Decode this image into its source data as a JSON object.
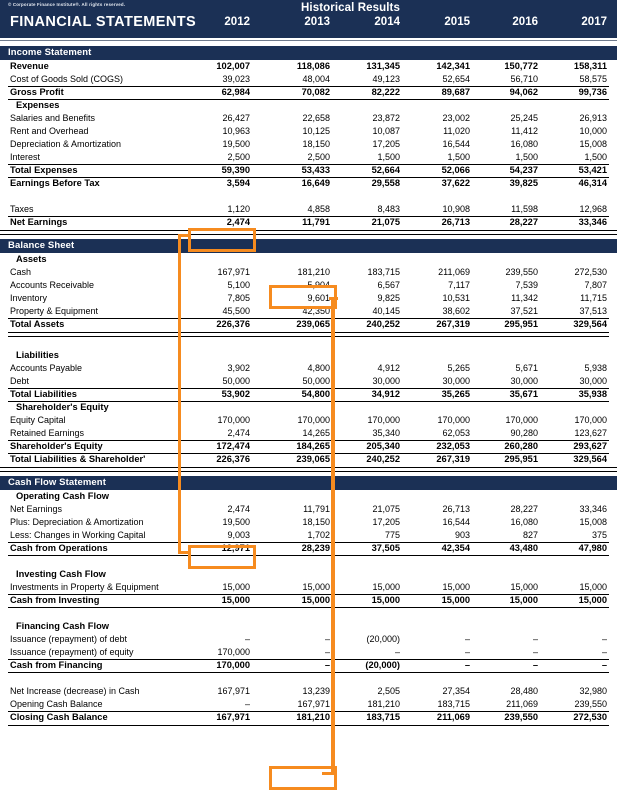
{
  "header": {
    "copyright": "© Corporate Finance Institute®. All rights reserved.",
    "historical_label": "Historical Results",
    "title": "FINANCIAL STATEMENTS",
    "years": [
      "2012",
      "2013",
      "2014",
      "2015",
      "2016",
      "2017"
    ],
    "background_color": "#1b3055",
    "text_color": "#ffffff"
  },
  "accent_color": "#F68B1F",
  "sections": [
    {
      "name": "income-statement",
      "title": "Income Statement",
      "rows": [
        {
          "label": "Revenue",
          "bold": true,
          "indent": false,
          "values": [
            "102,007",
            "118,086",
            "131,345",
            "142,341",
            "150,772",
            "158,311"
          ]
        },
        {
          "label": "Cost of Goods Sold (COGS)",
          "bold": false,
          "indent": false,
          "values": [
            "39,023",
            "48,004",
            "49,123",
            "52,654",
            "56,710",
            "58,575"
          ]
        },
        {
          "label": "Gross Profit",
          "bold": true,
          "indent": false,
          "values": [
            "62,984",
            "70,082",
            "82,222",
            "89,687",
            "94,062",
            "99,736"
          ]
        },
        {
          "label": "Expenses",
          "bold": true,
          "indent": true,
          "values": [
            "",
            "",
            "",
            "",
            "",
            ""
          ]
        },
        {
          "label": "Salaries and Benefits",
          "bold": false,
          "indent": false,
          "values": [
            "26,427",
            "22,658",
            "23,872",
            "23,002",
            "25,245",
            "26,913"
          ]
        },
        {
          "label": "Rent and Overhead",
          "bold": false,
          "indent": false,
          "values": [
            "10,963",
            "10,125",
            "10,087",
            "11,020",
            "11,412",
            "10,000"
          ]
        },
        {
          "label": "Depreciation & Amortization",
          "bold": false,
          "indent": false,
          "values": [
            "19,500",
            "18,150",
            "17,205",
            "16,544",
            "16,080",
            "15,008"
          ]
        },
        {
          "label": "Interest",
          "bold": false,
          "indent": false,
          "values": [
            "2,500",
            "2,500",
            "1,500",
            "1,500",
            "1,500",
            "1,500"
          ]
        },
        {
          "label": "Total Expenses",
          "bold": true,
          "indent": false,
          "values": [
            "59,390",
            "53,433",
            "52,664",
            "52,066",
            "54,237",
            "53,421"
          ]
        },
        {
          "label": "Earnings Before Tax",
          "bold": true,
          "indent": false,
          "values": [
            "3,594",
            "16,649",
            "29,558",
            "37,622",
            "39,825",
            "46,314"
          ]
        },
        {
          "label": "",
          "bold": false,
          "indent": false,
          "values": [
            "",
            "",
            "",
            "",
            "",
            ""
          ]
        },
        {
          "label": "Taxes",
          "bold": false,
          "indent": false,
          "values": [
            "1,120",
            "4,858",
            "8,483",
            "10,908",
            "11,598",
            "12,968"
          ]
        },
        {
          "label": "Net Earnings",
          "bold": true,
          "indent": false,
          "values": [
            "2,474",
            "11,791",
            "21,075",
            "26,713",
            "28,227",
            "33,346"
          ]
        }
      ]
    },
    {
      "name": "balance-sheet",
      "title": "Balance Sheet",
      "rows": [
        {
          "label": "Assets",
          "bold": true,
          "indent": true,
          "values": [
            "",
            "",
            "",
            "",
            "",
            ""
          ]
        },
        {
          "label": "Cash",
          "bold": false,
          "indent": false,
          "values": [
            "167,971",
            "181,210",
            "183,715",
            "211,069",
            "239,550",
            "272,530"
          ]
        },
        {
          "label": "Accounts Receivable",
          "bold": false,
          "indent": false,
          "values": [
            "5,100",
            "5,904",
            "6,567",
            "7,117",
            "7,539",
            "7,807"
          ]
        },
        {
          "label": "Inventory",
          "bold": false,
          "indent": false,
          "values": [
            "7,805",
            "9,601",
            "9,825",
            "10,531",
            "11,342",
            "11,715"
          ]
        },
        {
          "label": "Property & Equipment",
          "bold": false,
          "indent": false,
          "values": [
            "45,500",
            "42,350",
            "40,145",
            "38,602",
            "37,521",
            "37,513"
          ]
        },
        {
          "label": "Total Assets",
          "bold": true,
          "indent": false,
          "values": [
            "226,376",
            "239,065",
            "240,252",
            "267,319",
            "295,951",
            "329,564"
          ]
        },
        {
          "label": "",
          "bold": false,
          "indent": false,
          "values": [
            "",
            "",
            "",
            "",
            "",
            ""
          ]
        },
        {
          "label": "Liabilities",
          "bold": true,
          "indent": true,
          "values": [
            "",
            "",
            "",
            "",
            "",
            ""
          ]
        },
        {
          "label": "Accounts Payable",
          "bold": false,
          "indent": false,
          "values": [
            "3,902",
            "4,800",
            "4,912",
            "5,265",
            "5,671",
            "5,938"
          ]
        },
        {
          "label": "Debt",
          "bold": false,
          "indent": false,
          "values": [
            "50,000",
            "50,000",
            "30,000",
            "30,000",
            "30,000",
            "30,000"
          ]
        },
        {
          "label": "Total Liabilities",
          "bold": true,
          "indent": false,
          "values": [
            "53,902",
            "54,800",
            "34,912",
            "35,265",
            "35,671",
            "35,938"
          ]
        },
        {
          "label": "Shareholder's Equity",
          "bold": true,
          "indent": true,
          "values": [
            "",
            "",
            "",
            "",
            "",
            ""
          ]
        },
        {
          "label": "Equity Capital",
          "bold": false,
          "indent": false,
          "values": [
            "170,000",
            "170,000",
            "170,000",
            "170,000",
            "170,000",
            "170,000"
          ]
        },
        {
          "label": "Retained Earnings",
          "bold": false,
          "indent": false,
          "values": [
            "2,474",
            "14,265",
            "35,340",
            "62,053",
            "90,280",
            "123,627"
          ]
        },
        {
          "label": "Shareholder's Equity",
          "bold": true,
          "indent": false,
          "values": [
            "172,474",
            "184,265",
            "205,340",
            "232,053",
            "260,280",
            "293,627"
          ]
        },
        {
          "label": "Total Liabilities & Shareholder'",
          "bold": true,
          "indent": false,
          "values": [
            "226,376",
            "239,065",
            "240,252",
            "267,319",
            "295,951",
            "329,564"
          ]
        }
      ]
    },
    {
      "name": "cash-flow-statement",
      "title": "Cash Flow Statement",
      "rows": [
        {
          "label": "Operating Cash Flow",
          "bold": true,
          "indent": true,
          "values": [
            "",
            "",
            "",
            "",
            "",
            ""
          ]
        },
        {
          "label": "Net Earnings",
          "bold": false,
          "indent": false,
          "values": [
            "2,474",
            "11,791",
            "21,075",
            "26,713",
            "28,227",
            "33,346"
          ]
        },
        {
          "label": "Plus: Depreciation & Amortization",
          "bold": false,
          "indent": false,
          "values": [
            "19,500",
            "18,150",
            "17,205",
            "16,544",
            "16,080",
            "15,008"
          ]
        },
        {
          "label": "Less: Changes in Working Capital",
          "bold": false,
          "indent": false,
          "values": [
            "9,003",
            "1,702",
            "775",
            "903",
            "827",
            "375"
          ]
        },
        {
          "label": "Cash from Operations",
          "bold": true,
          "indent": false,
          "values": [
            "12,971",
            "28,239",
            "37,505",
            "42,354",
            "43,480",
            "47,980"
          ]
        },
        {
          "label": "",
          "bold": false,
          "indent": false,
          "values": [
            "",
            "",
            "",
            "",
            "",
            ""
          ]
        },
        {
          "label": "Investing Cash Flow",
          "bold": true,
          "indent": true,
          "values": [
            "",
            "",
            "",
            "",
            "",
            ""
          ]
        },
        {
          "label": "Investments in Property & Equipment",
          "bold": false,
          "indent": false,
          "values": [
            "15,000",
            "15,000",
            "15,000",
            "15,000",
            "15,000",
            "15,000"
          ]
        },
        {
          "label": "Cash from Investing",
          "bold": true,
          "indent": false,
          "values": [
            "15,000",
            "15,000",
            "15,000",
            "15,000",
            "15,000",
            "15,000"
          ]
        },
        {
          "label": "",
          "bold": false,
          "indent": false,
          "values": [
            "",
            "",
            "",
            "",
            "",
            ""
          ]
        },
        {
          "label": "Financing Cash Flow",
          "bold": true,
          "indent": true,
          "values": [
            "",
            "",
            "",
            "",
            "",
            ""
          ]
        },
        {
          "label": "Issuance (repayment) of debt",
          "bold": false,
          "indent": false,
          "values": [
            "–",
            "–",
            "(20,000)",
            "–",
            "–",
            "–"
          ]
        },
        {
          "label": "Issuance (repayment) of equity",
          "bold": false,
          "indent": false,
          "values": [
            "170,000",
            "–",
            "–",
            "–",
            "–",
            "–"
          ]
        },
        {
          "label": "Cash from Financing",
          "bold": true,
          "indent": false,
          "values": [
            "170,000",
            "–",
            "(20,000)",
            "–",
            "–",
            "–"
          ]
        },
        {
          "label": "",
          "bold": false,
          "indent": false,
          "values": [
            "",
            "",
            "",
            "",
            "",
            ""
          ]
        },
        {
          "label": "Net Increase (decrease) in Cash",
          "bold": false,
          "indent": false,
          "values": [
            "167,971",
            "13,239",
            "2,505",
            "27,354",
            "28,480",
            "32,980"
          ]
        },
        {
          "label": "Opening Cash Balance",
          "bold": false,
          "indent": false,
          "values": [
            "–",
            "167,971",
            "181,210",
            "183,715",
            "211,069",
            "239,550"
          ]
        },
        {
          "label": "Closing Cash Balance",
          "bold": true,
          "indent": false,
          "values": [
            "167,971",
            "181,210",
            "183,715",
            "211,069",
            "239,550",
            "272,530"
          ]
        }
      ]
    }
  ],
  "highlights": [
    {
      "name": "net-earnings-2012-highlight",
      "value": "2,474",
      "statement": "Income Statement",
      "row": "Net Earnings",
      "year": "2012"
    },
    {
      "name": "cash-2013-highlight",
      "value": "181,210",
      "statement": "Balance Sheet",
      "row": "Cash",
      "year": "2013"
    },
    {
      "name": "cf-net-earnings-2012-highlight",
      "value": "2,474",
      "statement": "Cash Flow Statement",
      "row": "Net Earnings",
      "year": "2012"
    },
    {
      "name": "closing-cash-balance-2013-highlight",
      "value": "181,210",
      "statement": "Cash Flow Statement",
      "row": "Closing Cash Balance",
      "year": "2013"
    }
  ]
}
